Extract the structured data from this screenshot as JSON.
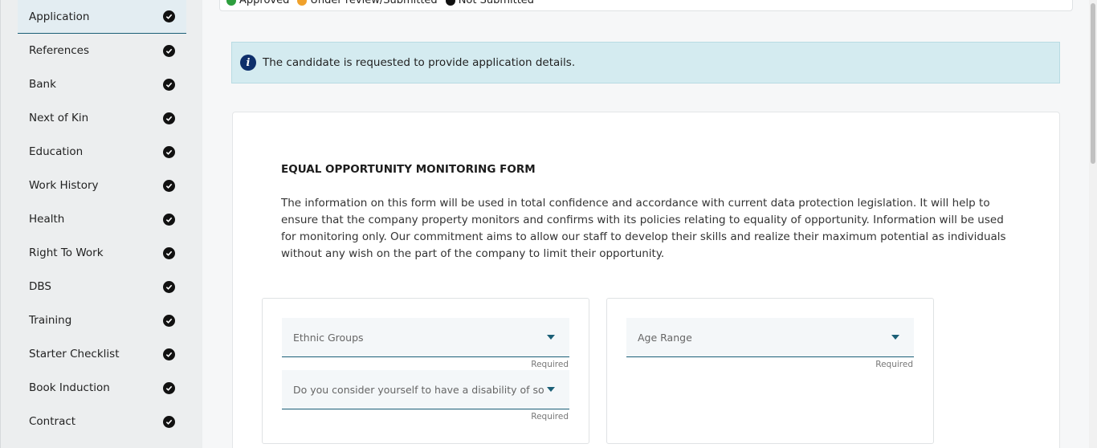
{
  "sidebar": {
    "items": [
      {
        "label": "Application",
        "status_icon": "check-circle-icon",
        "active": true
      },
      {
        "label": "References",
        "status_icon": "check-circle-icon"
      },
      {
        "label": "Bank",
        "status_icon": "check-circle-icon"
      },
      {
        "label": "Next of Kin",
        "status_icon": "check-circle-icon"
      },
      {
        "label": "Education",
        "status_icon": "check-circle-icon"
      },
      {
        "label": "Work History",
        "status_icon": "check-circle-icon"
      },
      {
        "label": "Health",
        "status_icon": "check-circle-icon"
      },
      {
        "label": "Right To Work",
        "status_icon": "check-circle-icon"
      },
      {
        "label": "DBS",
        "status_icon": "check-circle-icon"
      },
      {
        "label": "Training",
        "status_icon": "check-circle-icon"
      },
      {
        "label": "Starter Checklist",
        "status_icon": "check-circle-icon"
      },
      {
        "label": "Book Induction",
        "status_icon": "check-circle-icon"
      },
      {
        "label": "Contract",
        "status_icon": "check-circle-icon"
      }
    ]
  },
  "legend": {
    "approved": "Approved",
    "under_review": "Under review/Submitted",
    "not_submitted": "Not Submitted",
    "colors": {
      "approved": "#2e9e3e",
      "under_review": "#f0a12b",
      "not_submitted": "#111111"
    }
  },
  "info": {
    "icon": "info-icon",
    "text": "The candidate is requested to provide application details."
  },
  "form": {
    "title": "EQUAL OPPORTUNITY MONITORING FORM",
    "description": "The information on this form will be used in total confidence and accordance with current data protection legislation. It will help to ensure that the company property monitors and confirms with its policies relating to equality of opportunity. Information will be used for monitoring only. Our commitment aims to allow our staff to develop their skills and realize their maximum potential as individuals without any wish on the part of the company to limit their opportunity.",
    "fields": {
      "ethnic_groups": {
        "label": "Ethnic Groups",
        "hint": "Required"
      },
      "disability": {
        "label": "Do you consider yourself to have a disability of some kinc",
        "hint": "Required"
      },
      "age_range": {
        "label": "Age Range",
        "hint": "Required"
      }
    }
  },
  "colors": {
    "accent": "#1b5f77",
    "info_bg": "#d4ebf0",
    "sidebar_bg": "#eceeef"
  }
}
